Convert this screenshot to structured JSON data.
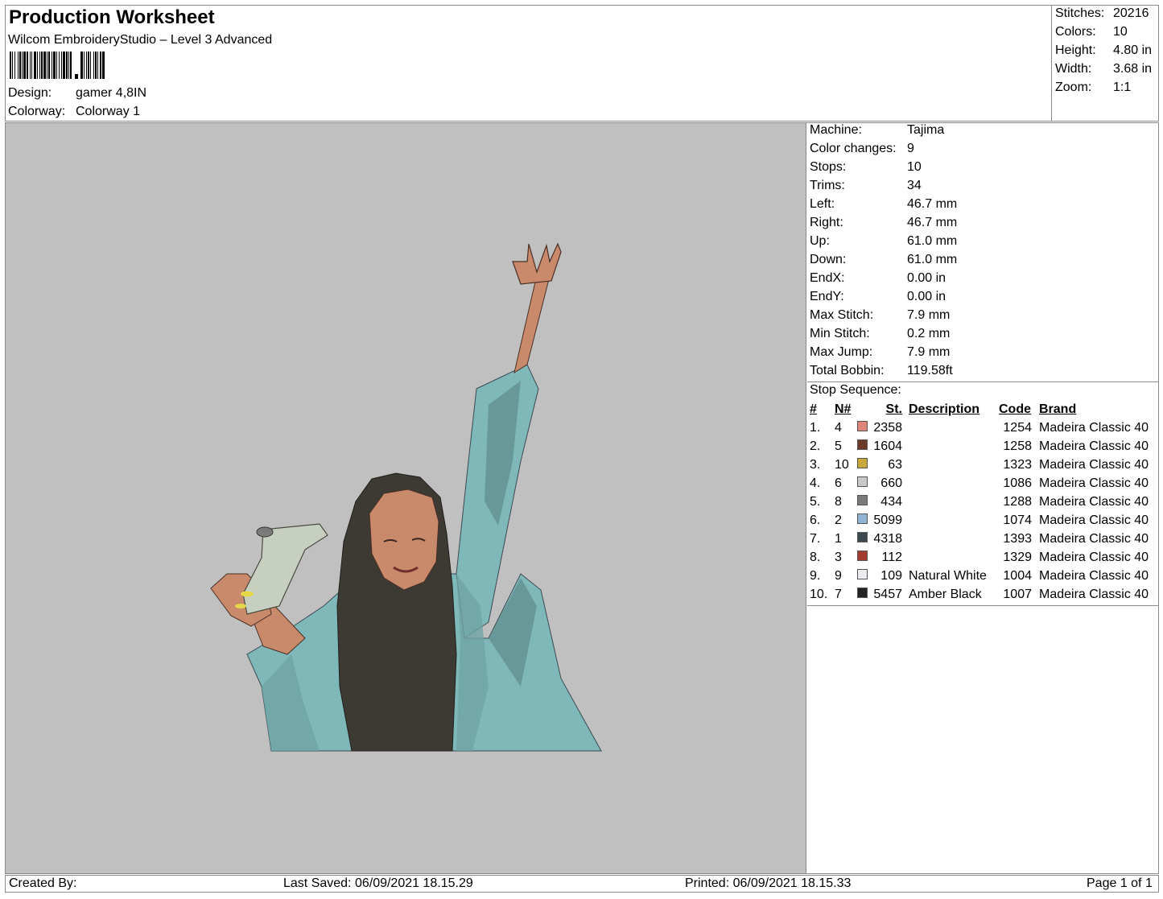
{
  "header": {
    "title": "Production Worksheet",
    "subtitle": "Wilcom EmbroideryStudio – Level 3 Advanced",
    "design_label": "Design:",
    "design_value": "gamer 4,8IN",
    "colorway_label": "Colorway:",
    "colorway_value": "Colorway 1"
  },
  "stats": [
    {
      "label": "Stitches:",
      "value": "20216"
    },
    {
      "label": "Colors:",
      "value": "10"
    },
    {
      "label": "Height:",
      "value": "4.80 in"
    },
    {
      "label": "Width:",
      "value": "3.68 in"
    },
    {
      "label": "Zoom:",
      "value": "1:1"
    }
  ],
  "machine_info": [
    {
      "label": "Machine:",
      "value": "Tajima"
    },
    {
      "label": "Color changes:",
      "value": "9"
    },
    {
      "label": "Stops:",
      "value": "10"
    },
    {
      "label": "Trims:",
      "value": "34"
    },
    {
      "label": "Left:",
      "value": "46.7 mm"
    },
    {
      "label": "Right:",
      "value": "46.7 mm"
    },
    {
      "label": "Up:",
      "value": "61.0 mm"
    },
    {
      "label": "Down:",
      "value": "61.0 mm"
    },
    {
      "label": "EndX:",
      "value": "0.00 in"
    },
    {
      "label": "EndY:",
      "value": "0.00 in"
    },
    {
      "label": "Max Stitch:",
      "value": "7.9 mm"
    },
    {
      "label": "Min Stitch:",
      "value": "0.2 mm"
    },
    {
      "label": "Max Jump:",
      "value": "7.9 mm"
    },
    {
      "label": "Total Bobbin:",
      "value": "119.58ft"
    }
  ],
  "stop_sequence": {
    "label": "Stop Sequence:",
    "columns": {
      "num": "#",
      "n": "N#",
      "st": "St.",
      "desc": "Description",
      "code": "Code",
      "brand": "Brand"
    },
    "rows": [
      {
        "num": "1.",
        "n": "4",
        "color": "#e0857a",
        "st": "2358",
        "desc": "",
        "code": "1254",
        "brand": "Madeira Classic 40"
      },
      {
        "num": "2.",
        "n": "5",
        "color": "#6b3a2a",
        "st": "1604",
        "desc": "",
        "code": "1258",
        "brand": "Madeira Classic 40"
      },
      {
        "num": "3.",
        "n": "10",
        "color": "#c8a83c",
        "st": "63",
        "desc": "",
        "code": "1323",
        "brand": "Madeira Classic 40"
      },
      {
        "num": "4.",
        "n": "6",
        "color": "#c8c8c8",
        "st": "660",
        "desc": "",
        "code": "1086",
        "brand": "Madeira Classic 40"
      },
      {
        "num": "5.",
        "n": "8",
        "color": "#7a7a7a",
        "st": "434",
        "desc": "",
        "code": "1288",
        "brand": "Madeira Classic 40"
      },
      {
        "num": "6.",
        "n": "2",
        "color": "#8fb4d4",
        "st": "5099",
        "desc": "",
        "code": "1074",
        "brand": "Madeira Classic 40"
      },
      {
        "num": "7.",
        "n": "1",
        "color": "#3c4a50",
        "st": "4318",
        "desc": "",
        "code": "1393",
        "brand": "Madeira Classic 40"
      },
      {
        "num": "8.",
        "n": "3",
        "color": "#a33a30",
        "st": "112",
        "desc": "",
        "code": "1329",
        "brand": "Madeira Classic 40"
      },
      {
        "num": "9.",
        "n": "9",
        "color": "#ecebef",
        "st": "109",
        "desc": "Natural White",
        "code": "1004",
        "brand": "Madeira Classic 40"
      },
      {
        "num": "10.",
        "n": "7",
        "color": "#222222",
        "st": "5457",
        "desc": "Amber Black",
        "code": "1007",
        "brand": "Madeira Classic 40"
      }
    ]
  },
  "footer": {
    "created_by": "Created By:",
    "last_saved": "Last Saved: 06/09/2021 18.15.29",
    "printed": "Printed: 06/09/2021 18.15.33",
    "page": "Page 1 of 1"
  }
}
